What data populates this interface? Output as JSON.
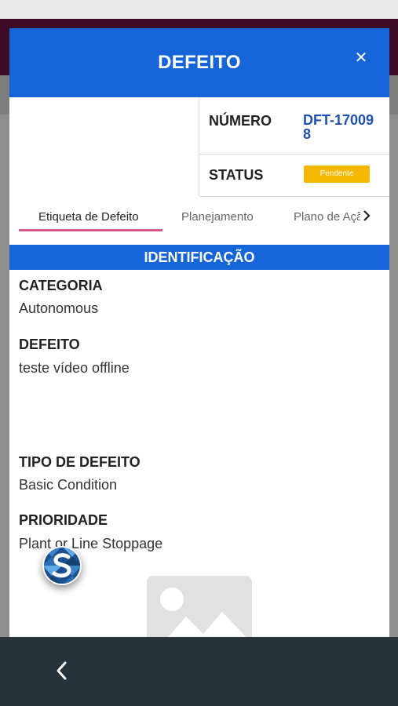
{
  "modal": {
    "title": "DEFEITO",
    "close_icon": "close-icon"
  },
  "info": {
    "numero_label": "NÚMERO",
    "numero_value": "DFT-170098",
    "status_label": "STATUS",
    "status_value": "Pendente"
  },
  "tabs": [
    {
      "label": "Etiqueta de Defeito",
      "active": true
    },
    {
      "label": "Planejamento",
      "active": false
    },
    {
      "label": "Plano de Ação",
      "active": false
    }
  ],
  "section": {
    "title": "IDENTIFICAÇÃO"
  },
  "fields": {
    "categoria": {
      "label": "CATEGORIA",
      "value": "Autonomous"
    },
    "defeito": {
      "label": "DEFEITO",
      "value": "teste vídeo offline"
    },
    "tipo": {
      "label": "TIPO DE DEFEITO",
      "value": "Basic Condition"
    },
    "prioridade": {
      "label": "PRIORIDADE",
      "value": "Plant or Line Stoppage"
    }
  },
  "colors": {
    "primary": "#1565d8",
    "status_pending": "#f5b800",
    "number_text": "#1f4fb5",
    "tab_underline": "#d9578c",
    "nav_bar": "#27333b"
  },
  "icons": [
    "close-icon",
    "chevron-right-icon",
    "image-placeholder-icon",
    "app-logo-icon",
    "back-arrow-icon"
  ]
}
